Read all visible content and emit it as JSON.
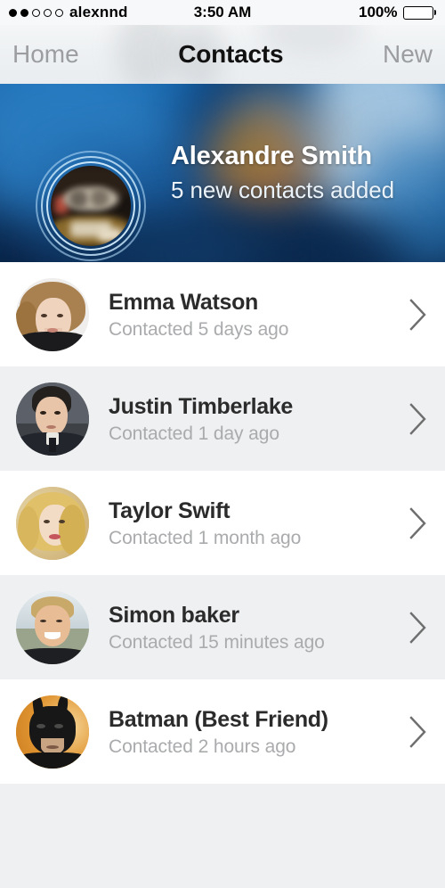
{
  "status_bar": {
    "carrier": "alexnnd",
    "signal_filled": 2,
    "signal_total": 5,
    "time": "3:50 AM",
    "battery_percent": "100%",
    "battery_level": 100
  },
  "nav_bar": {
    "back_label": "Home",
    "title": "Contacts",
    "action_label": "New"
  },
  "hero": {
    "name": "Alexandre Smith",
    "subtitle": "5 new contacts added",
    "avatar_name": "alexandre-smith-avatar"
  },
  "contacts": [
    {
      "name": "Emma Watson",
      "subtitle": "Contacted 5 days ago",
      "avatar_name": "emma-watson-avatar"
    },
    {
      "name": "Justin Timberlake",
      "subtitle": "Contacted 1 day ago",
      "avatar_name": "justin-timberlake-avatar"
    },
    {
      "name": "Taylor Swift",
      "subtitle": "Contacted 1 month ago",
      "avatar_name": "taylor-swift-avatar"
    },
    {
      "name": "Simon baker",
      "subtitle": "Contacted 15 minutes ago",
      "avatar_name": "simon-baker-avatar"
    },
    {
      "name": "Batman (Best Friend)",
      "subtitle": "Contacted 2 hours ago",
      "avatar_name": "batman-avatar"
    }
  ],
  "colors": {
    "nav_text_inactive": "#9b9da0",
    "nav_title": "#111111",
    "row_name": "#2b2b2b",
    "row_subtitle": "#aaabad",
    "row_alt_background": "#eef0f2",
    "chevron": "#6e6e6e",
    "hero_blue": "#1a6ab0"
  }
}
